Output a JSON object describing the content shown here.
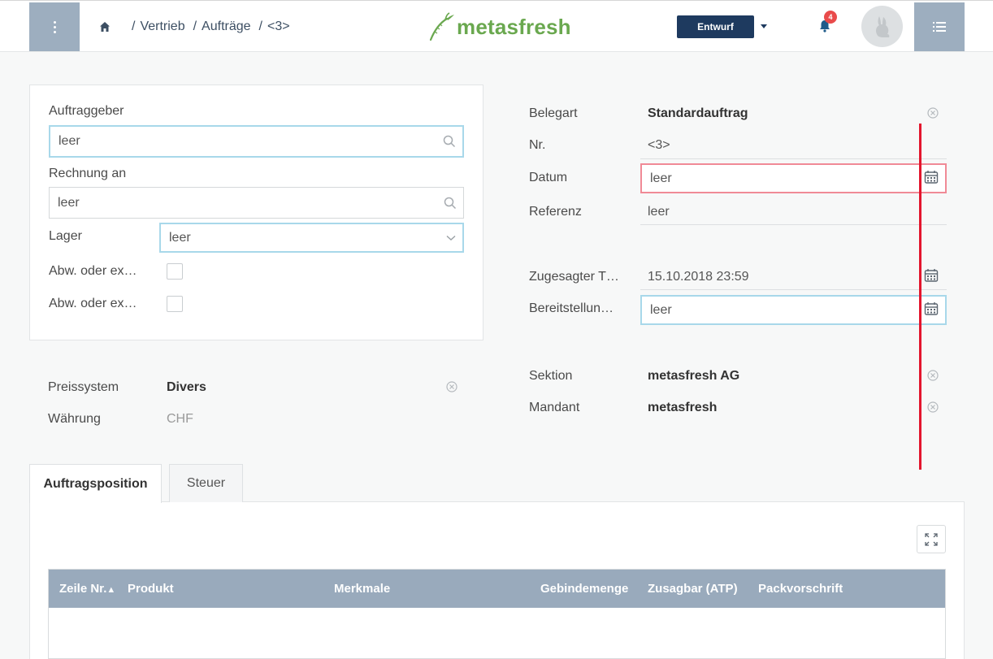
{
  "header": {
    "breadcrumbs": [
      "Vertrieb",
      "Aufträge",
      "<3>"
    ],
    "logo_text": "metasfresh",
    "status_label": "Entwurf",
    "notification_count": "4"
  },
  "left_panel": {
    "auftraggeber": {
      "label": "Auftraggeber",
      "value": "leer"
    },
    "rechnung_an": {
      "label": "Rechnung an",
      "value": "leer"
    },
    "lager": {
      "label": "Lager",
      "value": "leer"
    },
    "checkbox1_label": "Abw. oder ex…",
    "checkbox2_label": "Abw. oder ex…"
  },
  "pricing": {
    "preissystem_label": "Preissystem",
    "preissystem_value": "Divers",
    "waehrung_label": "Währung",
    "waehrung_value": "CHF"
  },
  "right_panel": {
    "belegart_label": "Belegart",
    "belegart_value": "Standardauftrag",
    "nr_label": "Nr.",
    "nr_value": "<3>",
    "datum_label": "Datum",
    "datum_value": "leer",
    "referenz_label": "Referenz",
    "referenz_value": "leer",
    "zugesagt_label": "Zugesagter T…",
    "zugesagt_value": "15.10.2018 23:59",
    "bereitstellung_label": "Bereitstellun…",
    "bereitstellung_value": "leer",
    "sektion_label": "Sektion",
    "sektion_value": "metasfresh AG",
    "mandant_label": "Mandant",
    "mandant_value": "metasfresh"
  },
  "tabs": [
    {
      "label": "Auftragsposition"
    },
    {
      "label": "Steuer"
    }
  ],
  "table": {
    "columns": [
      "Zeile Nr.",
      "Produkt",
      "Merkmale",
      "Gebindemenge",
      "Zusagbar (ATP)",
      "Packvorschrift"
    ],
    "sort_indicator": "▲"
  },
  "colors": {
    "accent": "#1e3a5f",
    "header_bar": "#9daebf",
    "logo_green": "#6aa84f",
    "error_border": "#f08a96",
    "focus_border": "#a8d8ea",
    "annotation_red": "#e3152d"
  }
}
